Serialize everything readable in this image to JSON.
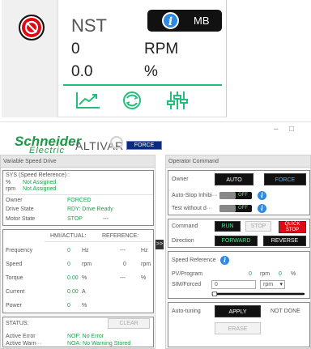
{
  "widget": {
    "title": "NST",
    "info_badge": "MB",
    "speed_value": "0",
    "speed_unit": "RPM",
    "load_value": "0.0",
    "load_unit": "%"
  },
  "window_controls": {
    "minimize": "–",
    "maximize": "□"
  },
  "header": {
    "brand_top": "Schneider",
    "brand_bottom": "Electric",
    "product": "ALTIVAR",
    "force_label": "FORCE"
  },
  "vsd": {
    "section_title": "Variable Speed Drive",
    "sys_title": "SYS (Speed Reference) :",
    "sys_rows": [
      {
        "unit": "%",
        "value": "Not Assigned"
      },
      {
        "unit": "rpm",
        "value": "Not Assigned"
      }
    ],
    "info_rows": [
      {
        "label": "Owner",
        "value": "FORCED",
        "extra": ""
      },
      {
        "label": "Drive State",
        "value": "RDY: Drive Ready",
        "extra": ""
      },
      {
        "label": "Motor State",
        "value": "STOP",
        "extra": "---"
      }
    ],
    "hmi_header": "HMI/ACTUAL:",
    "ref_header": "REFERENCE:",
    "measures": [
      {
        "label": "Frequency",
        "value": "0",
        "unit": "Hz",
        "ref": "---",
        "ref_unit": "Hz"
      },
      {
        "label": "Speed",
        "value": "0",
        "unit": "rpm",
        "ref": "0",
        "ref_unit": "rpm"
      },
      {
        "label": "Torque",
        "value": "0.00",
        "unit": "%",
        "ref": "---",
        "ref_unit": "%"
      },
      {
        "label": "Current",
        "value": "0.00",
        "unit": "A",
        "ref": "",
        "ref_unit": ""
      },
      {
        "label": "Power",
        "value": "0",
        "unit": "%",
        "ref": "",
        "ref_unit": ""
      }
    ],
    "status_title": "STATUS:",
    "clear_label": "CLEAR",
    "active_error_label": "Active Error",
    "active_error_value": "NOF: No Error",
    "active_warn_label": "Active Warn···",
    "active_warn_value": "NOA: No Warning Stored"
  },
  "collapse_arrow": ">>",
  "op": {
    "section_title": "Operator Command",
    "owner_label": "Owner",
    "auto_label": "AUTO",
    "force_label": "FORCE",
    "autostop_label": "Auto-Stop Inhibi···",
    "autostop_state": "OFF",
    "testwithout_label": "Test without d···",
    "testwithout_state": "OFF",
    "command_label": "Command",
    "run_label": "RUN",
    "stop_label": "STOP",
    "quick_stop_label": "QUICK STOP",
    "direction_label": "Direction",
    "forward_label": "FORWARD",
    "reverse_label": "REVERSE",
    "speed_ref_label": "Speed Reference",
    "pv_label": "PV/Program",
    "pv_value": "0",
    "pv_unit": "rpm",
    "pv_pct": "0",
    "pv_pct_unit": "%",
    "sim_label": "SIM/Forced",
    "sim_value": "0",
    "sim_unit": "rpm",
    "autotuning_label": "Auto-tuning",
    "apply_label": "APPLY",
    "not_done_label": "NOT DONE",
    "erase_label": "ERASE"
  },
  "colors": {
    "brand_green": "#1a9a47",
    "accent_green": "#21c07a",
    "accent_blue": "#2f89e0",
    "quick_stop_red": "#e30613"
  }
}
